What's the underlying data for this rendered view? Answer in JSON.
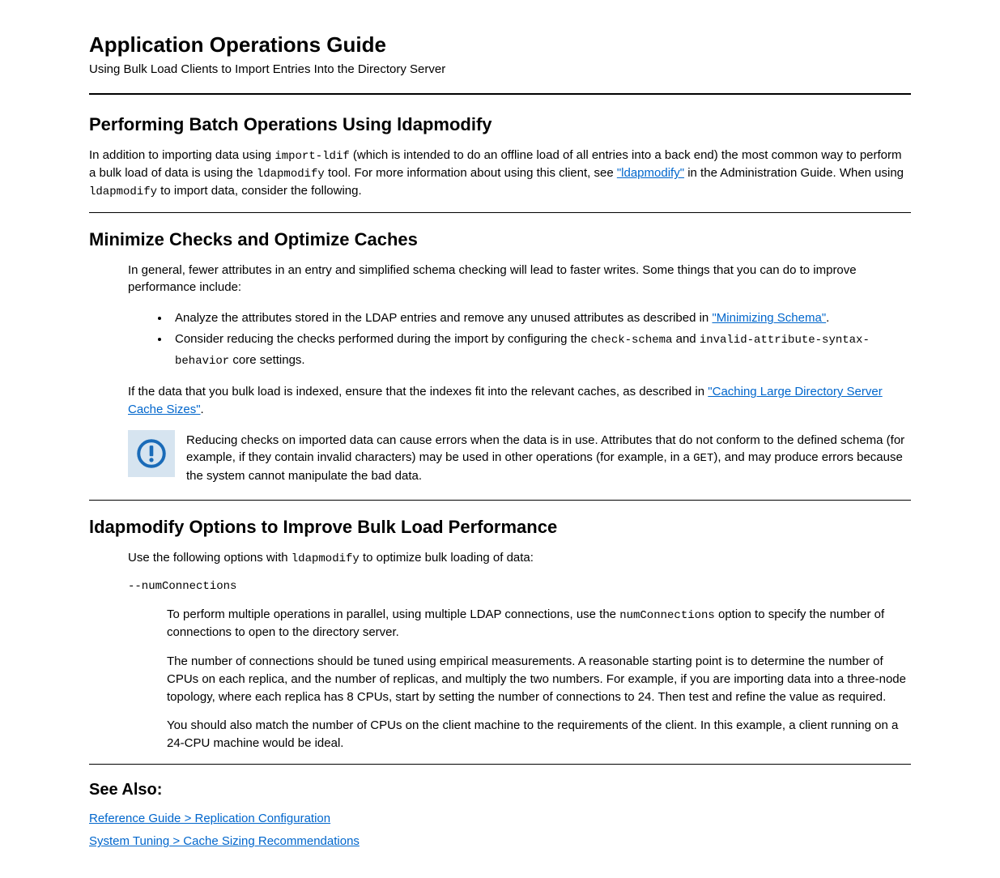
{
  "header": {
    "title": "Application Operations Guide",
    "subtitle": "Using Bulk Load Clients to Import Entries Into the Directory Server"
  },
  "s1": {
    "heading": "Performing Batch Operations Using ldapmodify",
    "p1_a": "In addition to importing data using ",
    "p1_code": "import-ldif",
    "p1_b": " (which is intended to do an offline load of all entries into a back end) the most common way to perform a bulk load of data is using the ",
    "p1_code2": "ldapmodify",
    "p1_c": " tool. For more information about using this client, see ",
    "p1_link": "\"ldapmodify\"",
    "p1_d": " in the Administration Guide. When using ",
    "p1_code3": "ldapmodify",
    "p1_e": " to import data, consider the following."
  },
  "s2": {
    "heading": "Minimize Checks and Optimize Caches",
    "p1": "In general, fewer attributes in an entry and simplified schema checking will lead to faster writes. Some things that you can do to improve performance include:",
    "bullet1_a": "Analyze the attributes stored in the LDAP entries and remove any unused attributes as described in ",
    "bullet1_link": "\"Minimizing Schema\"",
    "bullet1_b": ".",
    "bullet2_a": "Consider reducing the checks performed during the import by configuring the ",
    "bullet2_code": "check-schema",
    "bullet2_b": " and ",
    "bullet2_code2": "invalid-attribute-syntax-behavior",
    "bullet2_c": " core settings.",
    "p2_a": "If the data that you bulk load is indexed, ensure that the indexes fit into the relevant caches, as described in ",
    "p2_link": "\"Caching Large Directory Server Cache Sizes\"",
    "p2_b": ".",
    "note_a": "Reducing checks on imported data can cause errors when the data is in use. Attributes that do not conform to the defined schema (for example, if they contain invalid characters) may be used in other operations (for example, in a ",
    "note_code": "GET",
    "note_b": "), and may produce errors because the system cannot manipulate the bad data."
  },
  "s3": {
    "heading": "ldapmodify Options to Improve Bulk Load Performance",
    "p1_a": "Use the following options with ",
    "p1_code": "ldapmodify",
    "p1_b": " to optimize bulk loading of data:",
    "opt_code": "--numConnections",
    "opt_desc_a": "To perform multiple operations in parallel, using multiple LDAP connections, use the ",
    "opt_desc_code": "numConnections",
    "opt_desc_b": " option to specify the number of connections to open to the directory server.",
    "opt_p2": "The number of connections should be tuned using empirical measurements. A reasonable starting point is to determine the number of CPUs on each replica, and the number of replicas, and multiply the two numbers. For example, if you are importing data into a three-node topology, where each replica has 8 CPUs, start by setting the number of connections to 24. Then test and refine the value as required.",
    "opt_p3": "You should also match the number of CPUs on the client machine to the requirements of the client. In this example, a client running on a 24-CPU machine would be ideal."
  },
  "see_also": {
    "heading": "See Also:",
    "link1": "Reference Guide > Replication Configuration",
    "link2": "System Tuning > Cache Sizing Recommendations"
  }
}
